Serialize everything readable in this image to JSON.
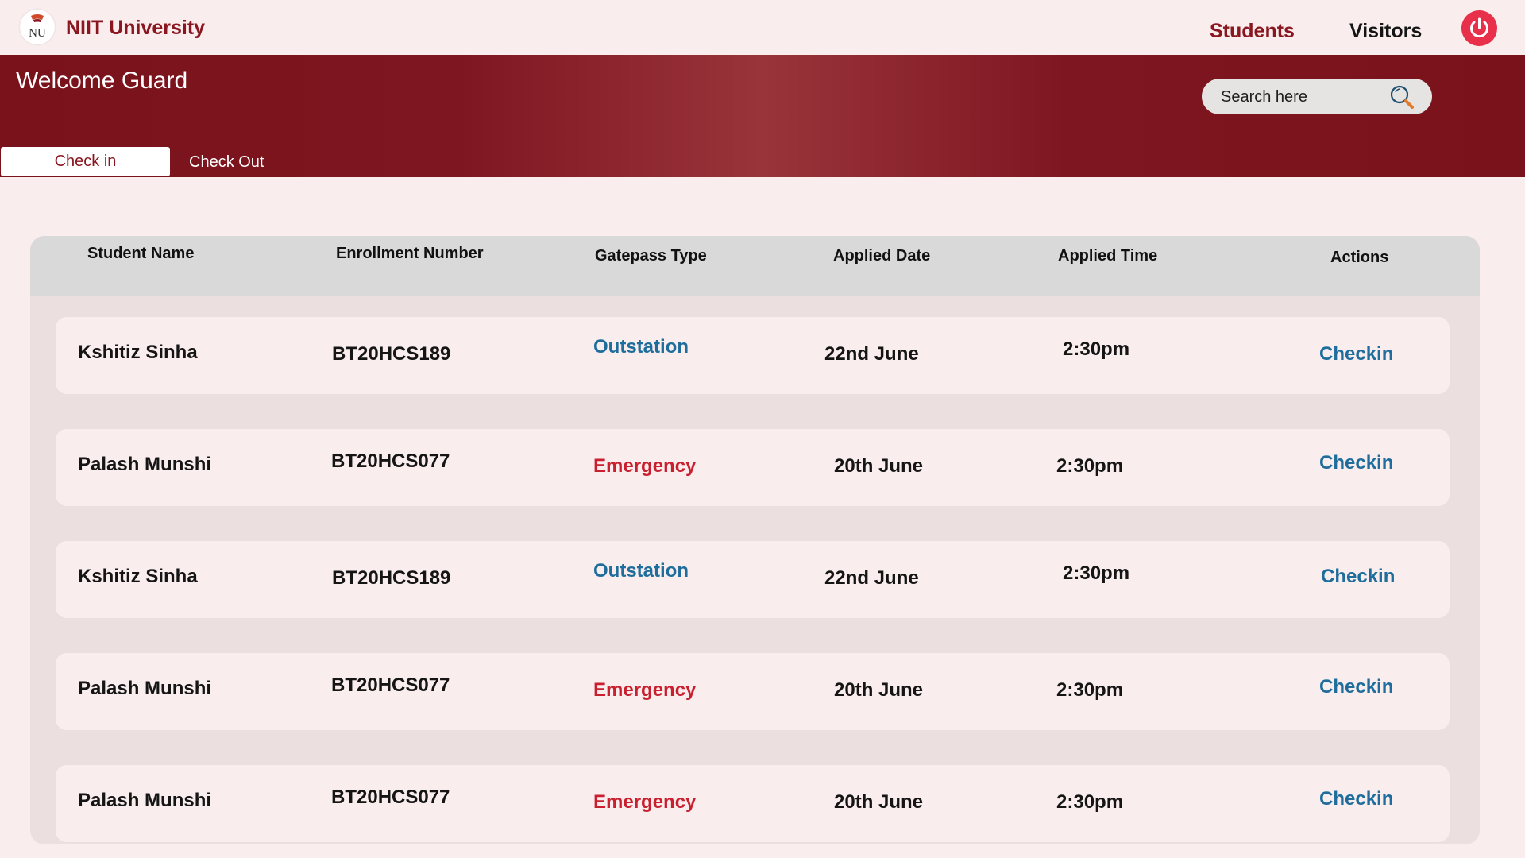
{
  "header": {
    "brand": "NIIT University",
    "logo_text": "NU",
    "nav": [
      "Students",
      "Visitors"
    ]
  },
  "banner": {
    "welcome": "Welcome Guard",
    "search_placeholder": "Search here",
    "tabs": [
      "Check in",
      "Check Out"
    ]
  },
  "table": {
    "columns": [
      "Student Name",
      "Enrollment Number",
      "Gatepass Type",
      "Applied Date",
      "Applied Time",
      "Actions"
    ],
    "rows": [
      {
        "name": "Kshitiz Sinha",
        "enrollment": "BT20HCS189",
        "type": "Outstation",
        "date": "22nd June",
        "time": "2:30pm",
        "action": "Checkin"
      },
      {
        "name": "Palash Munshi",
        "enrollment": "BT20HCS077",
        "type": "Emergency",
        "date": "20th June",
        "time": "2:30pm",
        "action": "Checkin"
      },
      {
        "name": "Kshitiz Sinha",
        "enrollment": "BT20HCS189",
        "type": "Outstation",
        "date": "22nd June",
        "time": "2:30pm",
        "action": "Checkin"
      },
      {
        "name": "Palash Munshi",
        "enrollment": "BT20HCS077",
        "type": "Emergency",
        "date": "20th June",
        "time": "2:30pm",
        "action": "Checkin"
      },
      {
        "name": "Palash Munshi",
        "enrollment": "BT20HCS077",
        "type": "Emergency",
        "date": "20th June",
        "time": "2:30pm",
        "action": "Checkin"
      }
    ]
  },
  "colors": {
    "brand": "#8a1620",
    "banner": "#7a121b",
    "outstation": "#1e6d9c",
    "emergency": "#c8202f",
    "power": "#e8304a"
  },
  "icons": [
    "niit-logo-icon",
    "power-icon",
    "search-icon"
  ]
}
